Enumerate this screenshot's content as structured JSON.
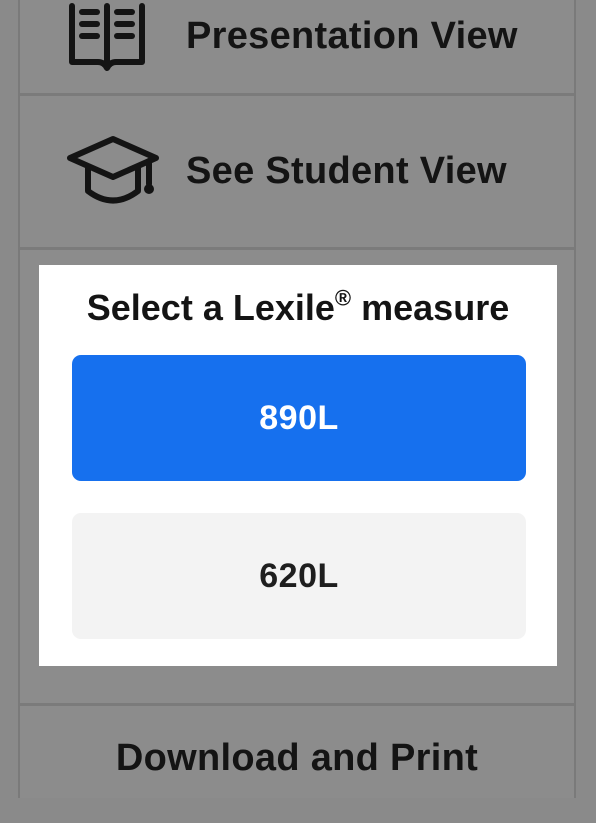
{
  "menu": {
    "presentation_label": "Presentation View",
    "student_label": "See Student View",
    "download_label": "Download and Print"
  },
  "lexile": {
    "title": "Select a Lexile",
    "title_mark": "®",
    "title_suffix": " measure",
    "options": [
      {
        "label": "890L",
        "selected": true
      },
      {
        "label": "620L",
        "selected": false
      }
    ]
  },
  "icons": {
    "presentation": "open-book-icon",
    "student": "graduation-cap-icon"
  },
  "colors": {
    "selected_option": "#1670ee",
    "unselected_option": "#f3f3f3",
    "overlay": "#8c8c8c",
    "card": "#ffffff"
  }
}
